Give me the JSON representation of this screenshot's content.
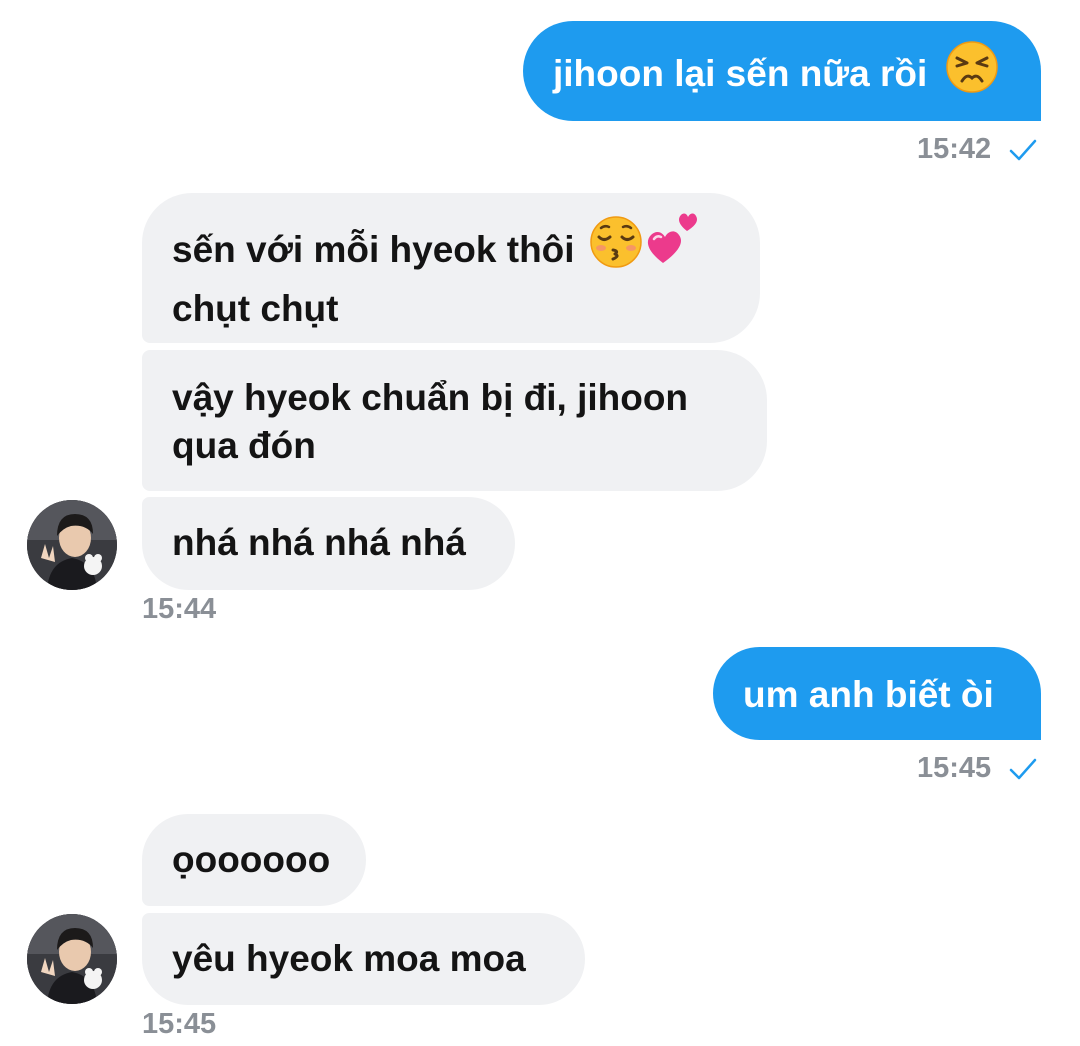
{
  "messages": [
    {
      "side": "outgoing",
      "text": "jihoon lại sến nữa rồi",
      "emoji": "persevering-face"
    },
    {
      "side": "outgoing_time",
      "time": "15:42",
      "read": true
    },
    {
      "side": "incoming",
      "line1": "sến với mỗi hyeok thôi",
      "line2": "chụt chụt",
      "emoji": [
        "kissing-face-closed-eyes",
        "two-hearts"
      ]
    },
    {
      "side": "incoming",
      "line1": "vậy hyeok chuẩn bị đi, jihoon",
      "line2": "qua đón"
    },
    {
      "side": "incoming",
      "text": "nhá nhá nhá nhá"
    },
    {
      "side": "incoming_time",
      "time": "15:44"
    },
    {
      "side": "outgoing",
      "text": "um anh biết òi"
    },
    {
      "side": "outgoing_time",
      "time": "15:45",
      "read": true
    },
    {
      "side": "incoming",
      "text": "ọoooooo"
    },
    {
      "side": "incoming",
      "text": "yêu hyeok moa moa"
    },
    {
      "side": "incoming_time",
      "time": "15:45"
    }
  ],
  "colors": {
    "outgoing_bubble": "#1e9bef",
    "incoming_bubble": "#f0f1f3",
    "timestamp": "#8a8f96",
    "read_check": "#1e9bef"
  }
}
